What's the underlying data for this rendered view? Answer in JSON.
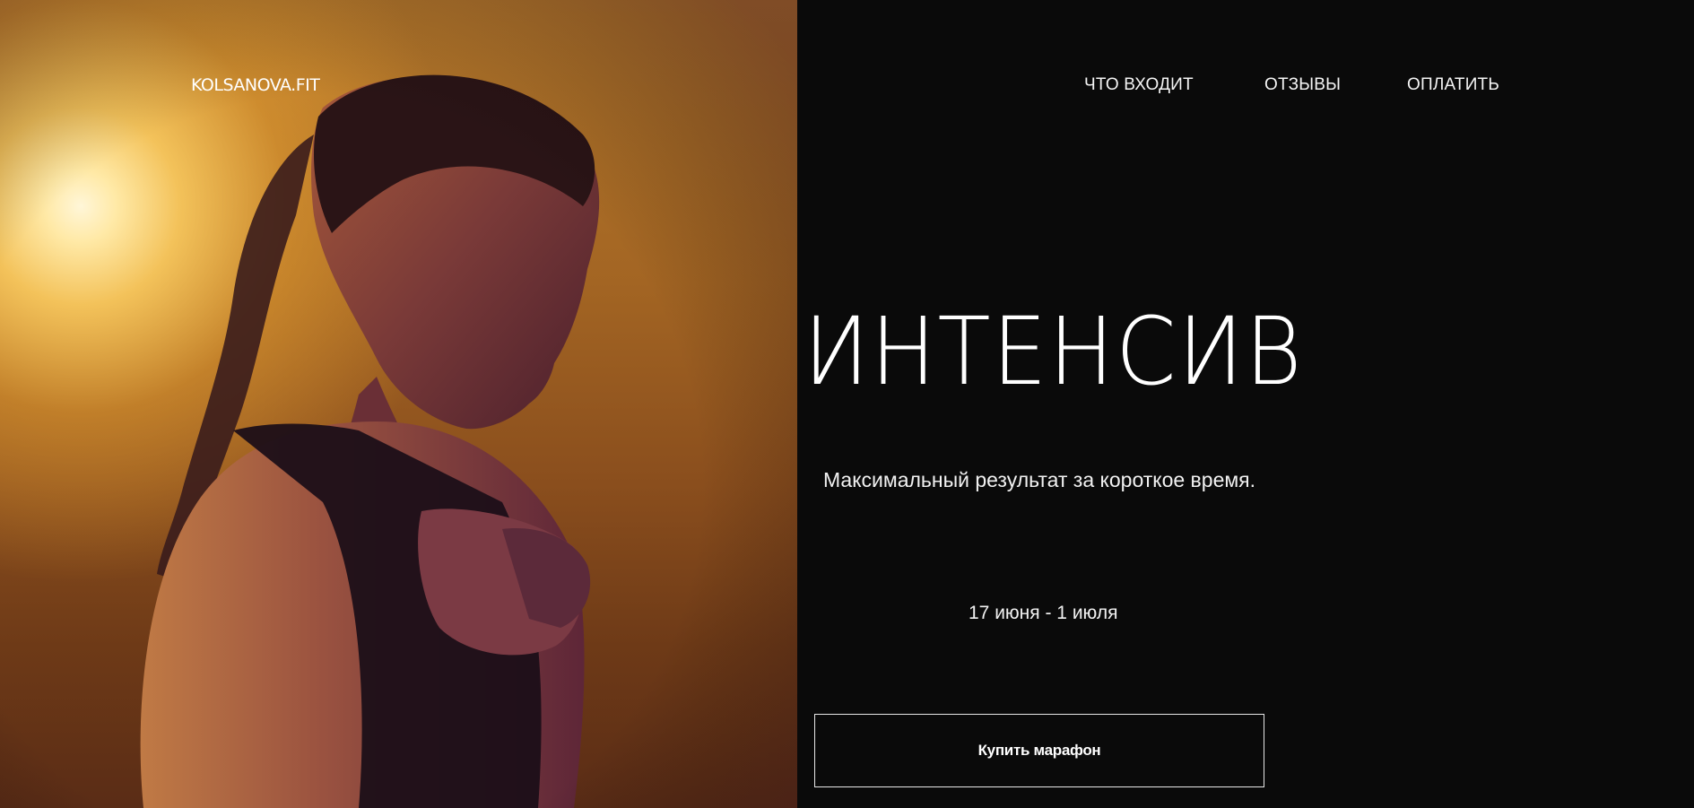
{
  "header": {
    "logo": "KOLSANOVA.FIT",
    "nav": [
      {
        "label": "ЧТО ВХОДИТ"
      },
      {
        "label": "ОТЗЫВЫ"
      },
      {
        "label": "ОПЛАТИТЬ"
      }
    ]
  },
  "hero": {
    "title": "ИНТЕНСИВ",
    "subtitle": "Максимальный результат за короткое время.",
    "dates": "17 июня - 1 июля",
    "cta_label": "Купить марафон",
    "photo_icon": "athlete-photo"
  },
  "colors": {
    "background": "#0a0a0a",
    "text": "#ffffff",
    "photo_glow": "#f3c25a"
  }
}
